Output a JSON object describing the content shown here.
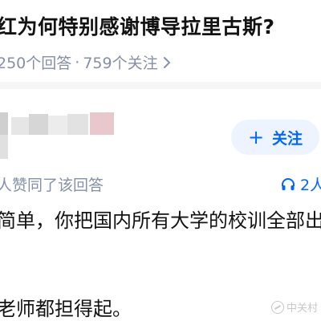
{
  "question": {
    "title": "红为何特别感谢博导拉里古斯?",
    "answers_count": "250个回答",
    "separator": "·",
    "followers_count": "759个关注"
  },
  "author": {
    "follow_label": "关注",
    "follow_icon": "plus-icon"
  },
  "answer": {
    "agree_text": "人赞同了该回答",
    "listen_count": "2人",
    "listen_icon": "headphones-icon",
    "lines": [
      "简单，你把国内所有大学的校训全部出",
      "老师都担得起。"
    ]
  },
  "watermark": {
    "text": "中关村"
  },
  "colors": {
    "accent": "#0066ff",
    "meta_gray": "#8590a6",
    "follow_bg": "#eef4ff"
  }
}
